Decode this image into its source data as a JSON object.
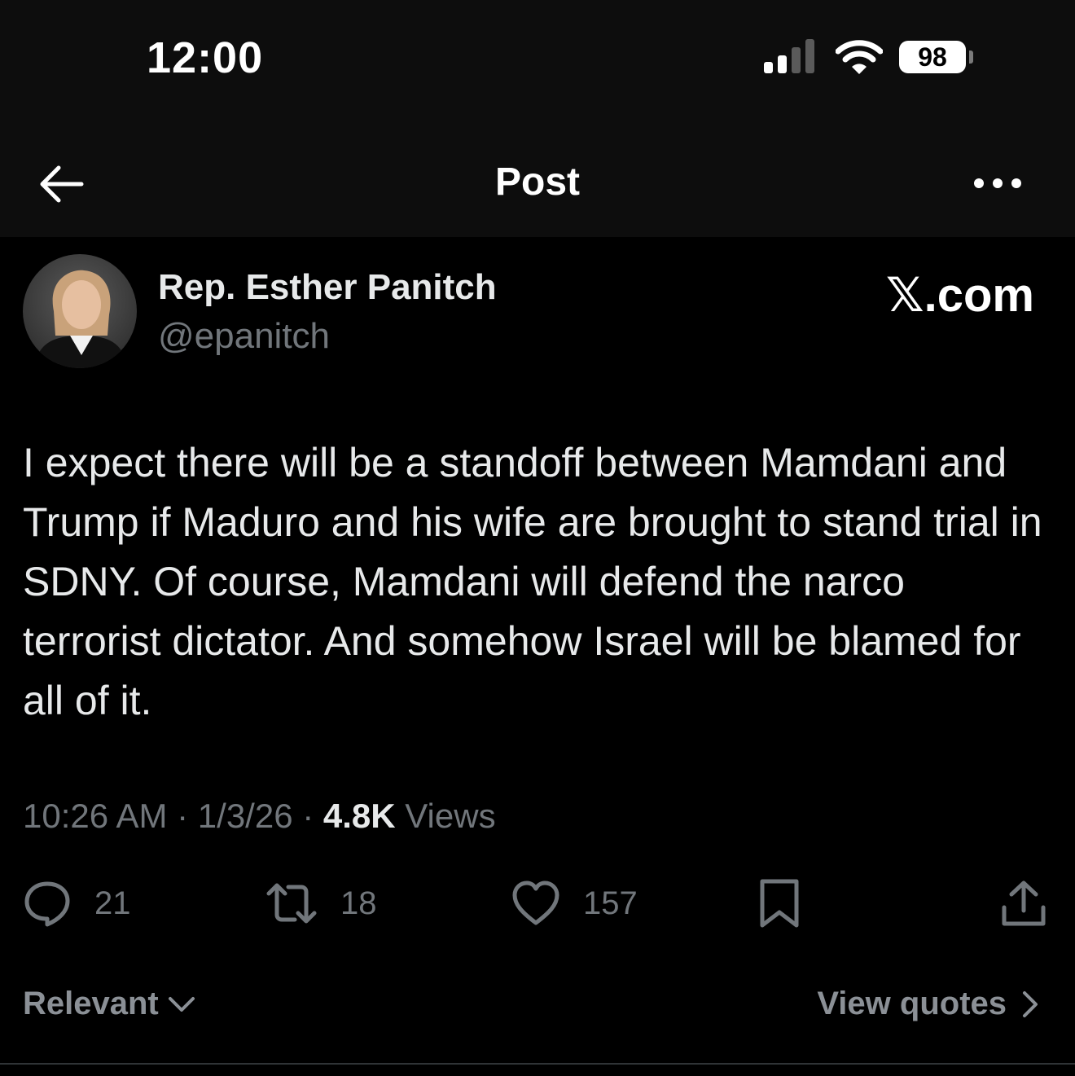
{
  "status_bar": {
    "time": "12:00",
    "battery": "98"
  },
  "nav": {
    "back_icon": "arrow-left-icon",
    "title": "Post",
    "more_icon": "more-horizontal-icon"
  },
  "post": {
    "author_name": "Rep. Esther Panitch",
    "handle": "@epanitch",
    "brand_watermark": "𝕏.com",
    "text": "I expect there will be a standoff between Mamdani and Trump if Maduro and his wife are brought to stand trial in SDNY. Of course, Mamdani will defend the narco terrorist dictator. And somehow Israel will be blamed for all of it.",
    "time": "10:26 AM",
    "date": "1/3/26",
    "views_count": "4.8K",
    "views_label": "Views"
  },
  "actions": {
    "replies": "21",
    "reposts": "18",
    "likes": "157"
  },
  "footer": {
    "sort_label": "Relevant",
    "view_quotes_label": "View quotes"
  },
  "colors": {
    "background": "#000000",
    "header_bg": "#0d0d0d",
    "primary_text": "#e7e9ea",
    "secondary_text": "#71767b"
  }
}
